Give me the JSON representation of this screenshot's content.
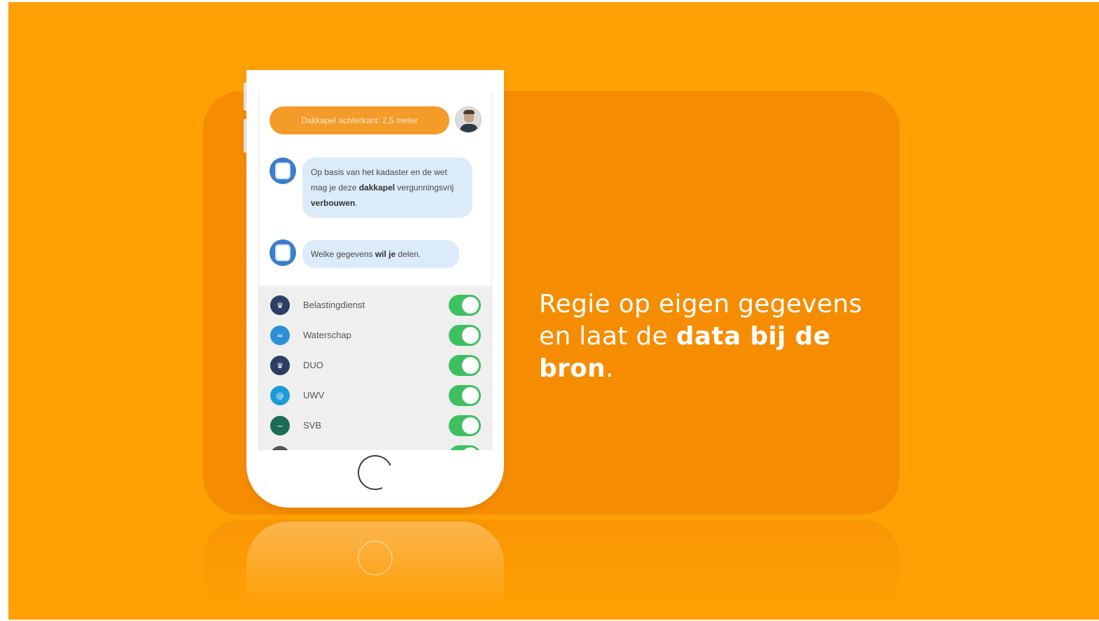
{
  "chat": {
    "user_message": "Dakkapel achterkant: 2,5 meter",
    "bot_message_1_part1": "Op basis van het kadaster en de wet mag je deze ",
    "bot_message_1_bold1": "dakkapel",
    "bot_message_1_part2": " vergunningsvrij ",
    "bot_message_1_bold2": "verbouwen",
    "bot_message_1_end": ".",
    "bot_message_2_part1": "Welke gegevens ",
    "bot_message_2_bold": "wil je",
    "bot_message_2_part2": " delen."
  },
  "share_list": {
    "items": [
      {
        "label": "Belastingdienst",
        "icon": "crown-seal-icon",
        "color": "#2c3e63",
        "enabled": true
      },
      {
        "label": "Waterschap",
        "icon": "water-wave-icon",
        "color": "#2d8fd6",
        "enabled": true
      },
      {
        "label": "DUO",
        "icon": "crown-seal-icon",
        "color": "#2c3e63",
        "enabled": true
      },
      {
        "label": "UWV",
        "icon": "uwv-swirl-icon",
        "color": "#1c9bd8",
        "enabled": true
      },
      {
        "label": "SVB",
        "icon": "svb-logo-icon",
        "color": "#1d6b55",
        "enabled": true
      }
    ]
  },
  "headline": {
    "line1": "Regie op eigen gegevens",
    "line2_prefix": "en laat de ",
    "line2_bold": "data bij de bron",
    "line2_suffix": "."
  },
  "colors": {
    "background": "#ffa005",
    "card": "#f68c00",
    "user_bubble": "#f49b2a",
    "bot_bubble": "#dcebf9",
    "toggle_on": "#3fc060"
  }
}
